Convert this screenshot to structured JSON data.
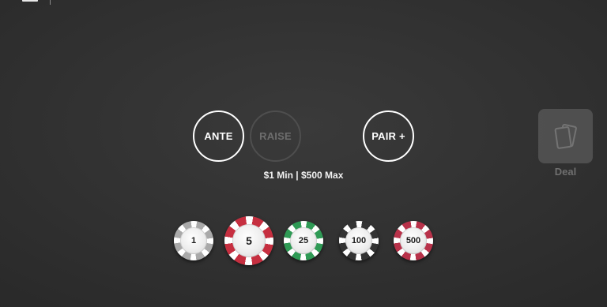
{
  "bets": {
    "ante": {
      "label": "ANTE",
      "state": "active"
    },
    "raise": {
      "label": "RAISE",
      "state": "disabled"
    },
    "pair_plus": {
      "label": "PAIR +",
      "state": "active"
    }
  },
  "limits_text": "$1 Min | $500 Max",
  "deal": {
    "label": "Deal",
    "state": "disabled",
    "icon": "cards-icon"
  },
  "chips": [
    {
      "value": "1",
      "edge_color": "#a9a9a9",
      "stripe_color": "#ffffff",
      "selected": false
    },
    {
      "value": "5",
      "edge_color": "#c62f40",
      "stripe_color": "#ffffff",
      "selected": true
    },
    {
      "value": "25",
      "edge_color": "#2f9a55",
      "stripe_color": "#ffffff",
      "selected": false
    },
    {
      "value": "100",
      "edge_color": "#333333",
      "stripe_color": "#ffffff",
      "selected": false
    },
    {
      "value": "500",
      "edge_color": "#b8324a",
      "stripe_color": "#ffffff",
      "selected": false
    }
  ],
  "colors": {
    "background": "#303030",
    "active_outline": "#ffffff",
    "disabled_outline": "#4e4e4e",
    "disabled_text": "#6d6d6d"
  }
}
